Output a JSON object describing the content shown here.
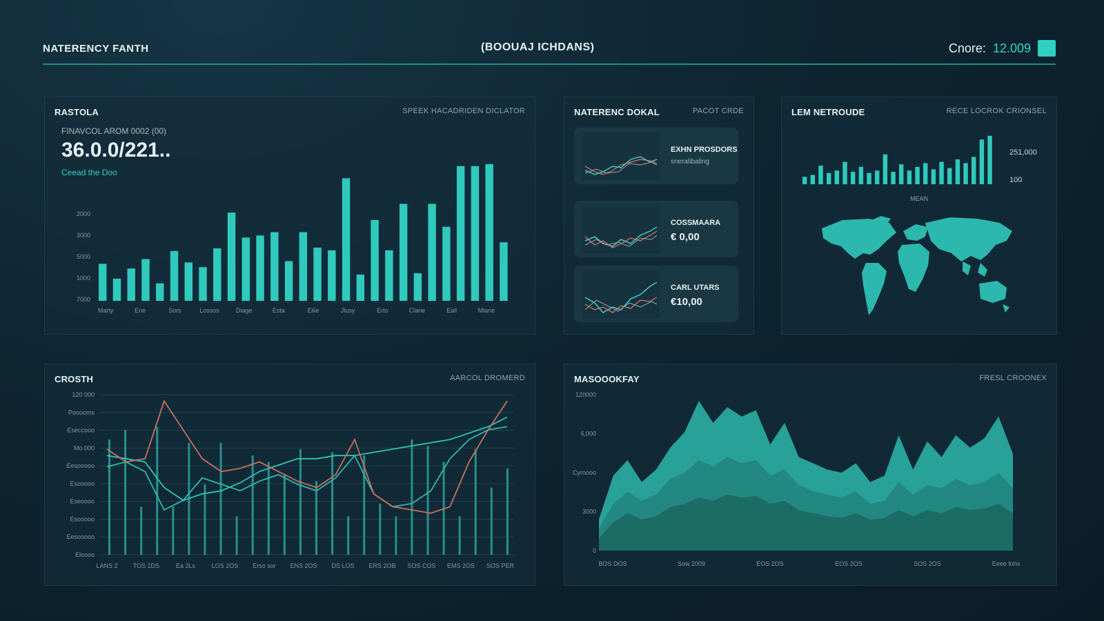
{
  "header": {
    "app_title": "NATERENCY FANTH",
    "center_title": "(BOOUAJ ICHDANS)",
    "score_label": "Cnore:",
    "score_value": "12.009",
    "accent": "#2fd0c4"
  },
  "panel_main": {
    "title": "RASTOLA",
    "subtitle": "SPEEK HACADRIDEN DICLATOR",
    "kpi_label": "FINAVCOL AROM 0002 (00)",
    "kpi_value": "36.0.0/221..",
    "kpi_link": "Ceead the Doo",
    "y_ticks": [
      "2000",
      "3000",
      "5000",
      "1000",
      "7000"
    ],
    "x_ticks": [
      "Marty",
      "Ene",
      "Sors",
      "Lossos",
      "Diage",
      "Esta",
      "Eliie",
      "Jlusy",
      "Erto",
      "Clane",
      "Eall",
      "Mlane"
    ],
    "chart_data": {
      "type": "bar",
      "values": [
        55,
        33,
        48,
        62,
        26,
        74,
        57,
        50,
        78,
        131,
        94,
        97,
        102,
        59,
        102,
        79,
        75,
        182,
        39,
        120,
        75,
        144,
        41,
        144,
        110,
        200,
        200,
        203,
        87
      ]
    }
  },
  "panel_mini": {
    "title": "NATERENC DOKAL",
    "subtitle": "PACOT CRDE",
    "cards": [
      {
        "label": "EXHN PROSDORS",
        "sub": "sneralibaling",
        "value": ""
      },
      {
        "label": "COSSMAARA",
        "sub": "",
        "value": "€ 0,00"
      },
      {
        "label": "CARL UTARS",
        "sub": "",
        "value": "€10,00"
      }
    ]
  },
  "panel_map": {
    "title": "LEM NETROUDE",
    "subtitle": "RECE LOCROK CRIONSEL",
    "bar_label_top": "251,000",
    "bar_label_bottom": "100",
    "axis_label": "MEAN",
    "chart_data": {
      "type": "bar",
      "values": [
        12,
        15,
        30,
        18,
        22,
        36,
        20,
        28,
        18,
        22,
        48,
        20,
        32,
        22,
        28,
        34,
        24,
        36,
        26,
        40,
        34,
        44,
        72,
        78
      ]
    }
  },
  "panel_growth": {
    "title": "CROSTH",
    "subtitle": "AARCOL DROMERD",
    "y_ticks": [
      "120 000",
      "Pooooms",
      "Eseccooo",
      "Mo.000",
      "Eesooooo",
      "Esooooo",
      "Eseoooo",
      "Esooooo",
      "Eesooooo",
      "Eloooo"
    ],
    "x_ticks": [
      "LANS 2",
      "TOS 1DS",
      "Ea 2Ls",
      "LOS 2OS",
      "Erso sor",
      "ENS 2OS",
      "DS LOS",
      "ERS 2OB",
      "SOS COS",
      "EMS 2OS",
      "SOS PER"
    ],
    "chart_data": {
      "type": "line",
      "series": [
        {
          "values": [
            55,
            58,
            52,
            28,
            34,
            48,
            44,
            40,
            46,
            50,
            44,
            40,
            48,
            62,
            38,
            30,
            32,
            40,
            60,
            72,
            78,
            80
          ]
        },
        {
          "values": [
            62,
            60,
            58,
            42,
            34,
            38,
            40,
            45,
            52,
            56,
            60,
            60,
            62,
            62,
            64,
            66,
            68,
            70,
            72,
            76,
            80,
            86
          ]
        },
        {
          "values": [
            66,
            58,
            60,
            96,
            78,
            60,
            52,
            54,
            58,
            52,
            46,
            42,
            50,
            72,
            38,
            30,
            28,
            26,
            30,
            58,
            78,
            96
          ]
        }
      ],
      "bars": [
        72,
        78,
        30,
        80,
        30,
        70,
        44,
        70,
        24,
        62,
        58,
        50,
        66,
        46,
        64,
        24,
        62,
        32,
        24,
        72,
        68,
        58,
        24,
        66,
        42,
        54
      ]
    }
  },
  "panel_area": {
    "title": "MASOOOKFAY",
    "subtitle": "FRESL CROONEX",
    "y_ticks": [
      "120000",
      "6,000",
      "Cyroooo",
      "3000",
      "0"
    ],
    "x_ticks": [
      "BOS DOS",
      "Sow 2009",
      "EOS 2OS",
      "EOS 2OS",
      "SOS 2OS",
      "Eeee fohs"
    ],
    "chart_data": {
      "type": "area",
      "series": [
        {
          "values": [
            20,
            48,
            58,
            44,
            52,
            66,
            76,
            96,
            82,
            92,
            86,
            90,
            68,
            82,
            60,
            56,
            52,
            50,
            56,
            44,
            48,
            74,
            52,
            70,
            60,
            74,
            66,
            72,
            86,
            62
          ]
        },
        {
          "values": [
            14,
            30,
            38,
            32,
            36,
            46,
            50,
            58,
            54,
            60,
            56,
            58,
            48,
            52,
            42,
            38,
            36,
            34,
            38,
            30,
            32,
            44,
            36,
            42,
            40,
            46,
            42,
            44,
            50,
            40
          ]
        },
        {
          "values": [
            8,
            18,
            24,
            20,
            22,
            28,
            30,
            34,
            32,
            36,
            34,
            35,
            30,
            32,
            26,
            24,
            22,
            21,
            24,
            20,
            21,
            26,
            22,
            26,
            24,
            28,
            26,
            27,
            30,
            24
          ]
        }
      ]
    }
  }
}
